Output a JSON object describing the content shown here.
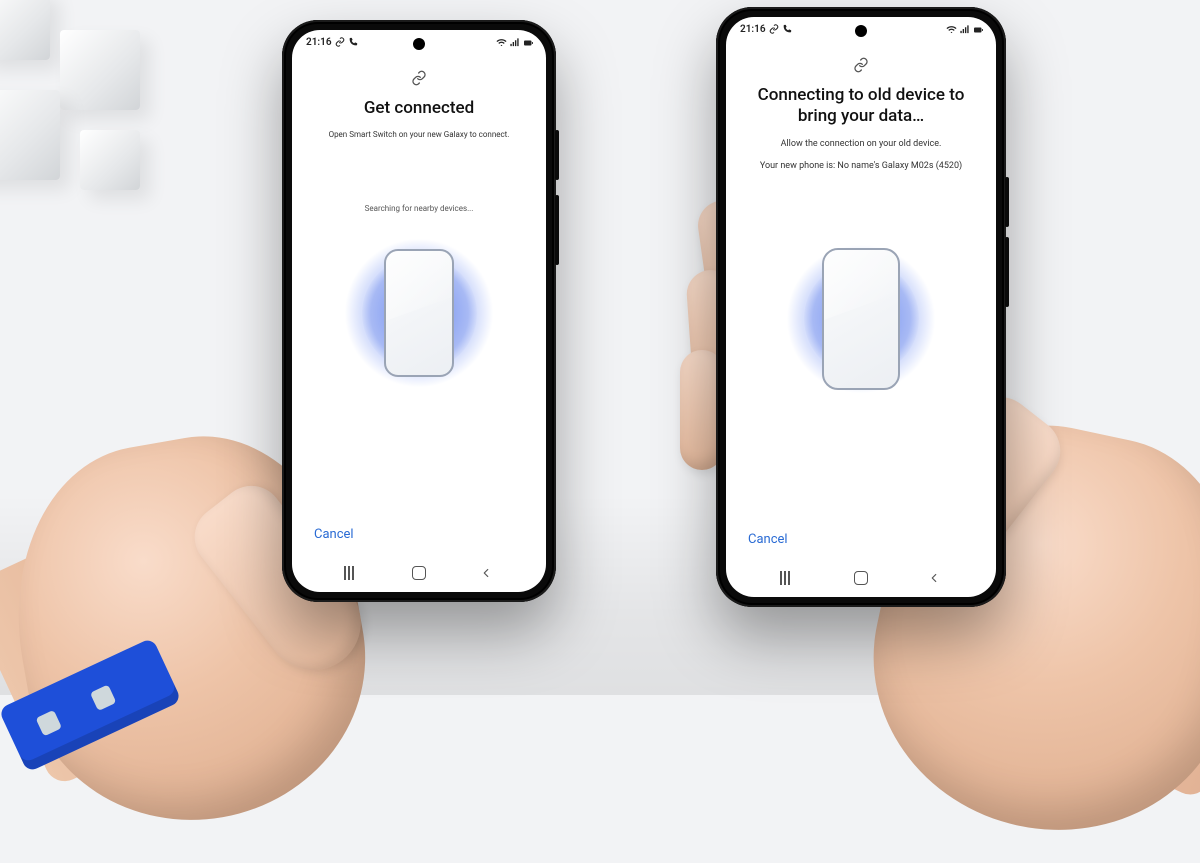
{
  "colors": {
    "accent_blue": "#2a6bd4",
    "pulse_blue": "#6385f2"
  },
  "statusbar": {
    "time": "21:16",
    "icons_left": [
      "link-mini-icon",
      "phone-mini-icon"
    ],
    "icons_right": [
      "wifi-icon",
      "signal-icon",
      "battery-icon"
    ]
  },
  "phone_left": {
    "link_icon": "link-icon",
    "title": "Get connected",
    "subtitle": "Open Smart Switch on your new Galaxy to connect.",
    "searching_label": "Searching for nearby devices...",
    "cancel_label": "Cancel"
  },
  "phone_right": {
    "link_icon": "link-icon",
    "title": "Connecting to old device to bring your data…",
    "subtitle": "Allow the connection on your old device.",
    "device_line": "Your new phone is: No name's Galaxy M02s (4520)",
    "cancel_label": "Cancel"
  },
  "navbar": {
    "recent": "recent-apps",
    "home": "home",
    "back": "back"
  }
}
